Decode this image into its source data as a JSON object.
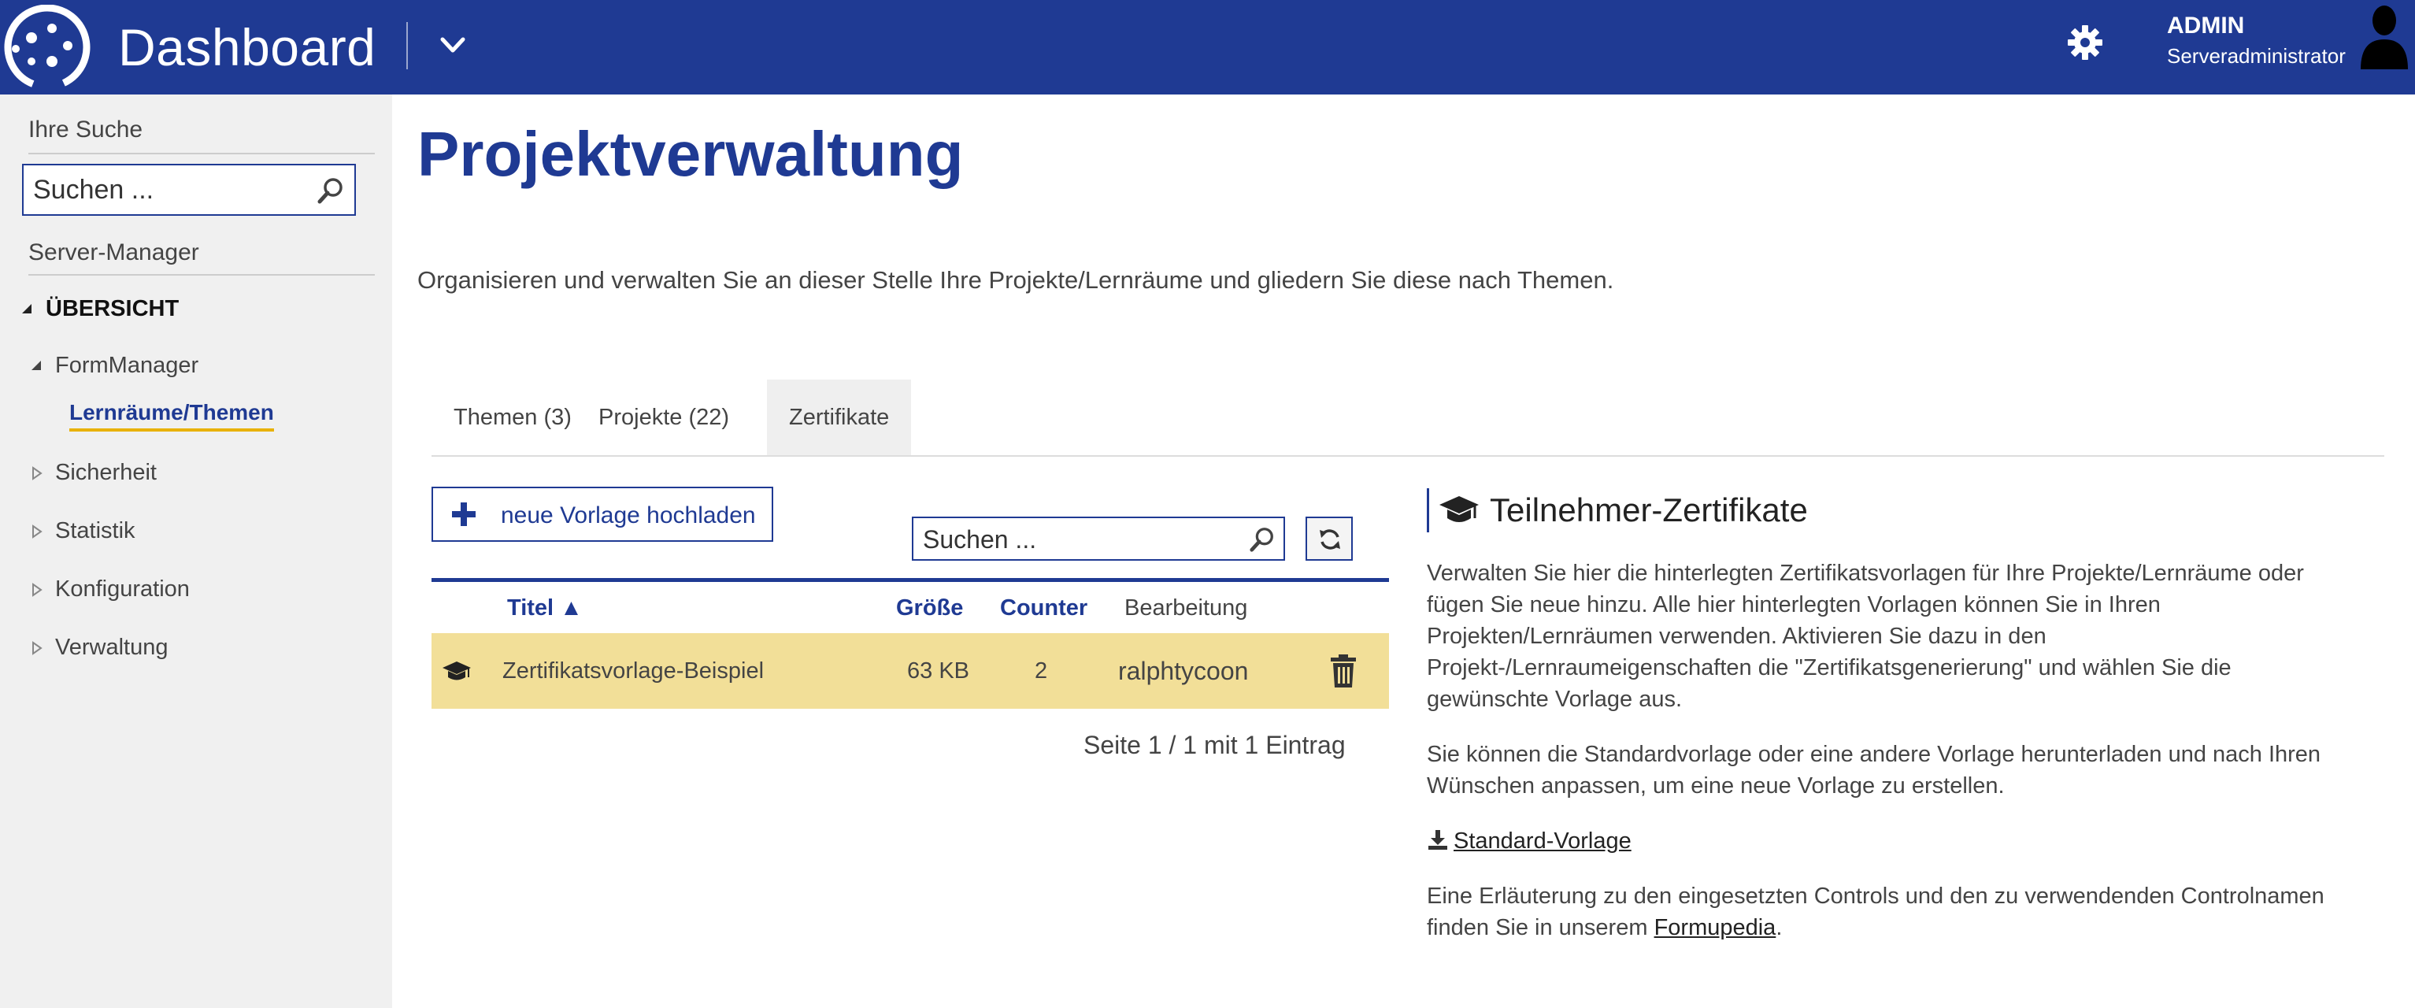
{
  "header": {
    "brand": "Dashboard",
    "user": {
      "name": "ADMIN",
      "role": "Serveradministrator"
    },
    "colors": {
      "primary": "#1f3a93"
    }
  },
  "sidebar": {
    "search_label": "Ihre Suche",
    "search_placeholder": "Suchen ...",
    "section_label": "Server-Manager",
    "overview": "ÜBERSICHT",
    "formmanager": "FormManager",
    "active_item": "Lernräume/Themen",
    "items": [
      {
        "label": "Sicherheit"
      },
      {
        "label": "Statistik"
      },
      {
        "label": "Konfiguration"
      },
      {
        "label": "Verwaltung"
      }
    ]
  },
  "main": {
    "title": "Projektverwaltung",
    "description": "Organisieren und verwalten Sie an dieser Stelle Ihre Projekte/Lernräume und gliedern Sie diese nach Themen.",
    "tabs": [
      {
        "label": "Themen (3)"
      },
      {
        "label": "Projekte (22)"
      },
      {
        "label": "Zertifikate",
        "active": true
      }
    ],
    "upload_button": "neue Vorlage hochladen",
    "search_placeholder": "Suchen ...",
    "table": {
      "columns": {
        "title": "Titel ▲",
        "size": "Größe",
        "counter": "Counter",
        "edit": "Bearbeitung"
      },
      "rows": [
        {
          "title": "Zertifikatsvorlage-Beispiel",
          "size": "63 KB",
          "counter": "2",
          "edit": "ralphtycoon"
        }
      ],
      "pager": "Seite 1 / 1 mit 1 Eintrag",
      "row_highlight": "#f2df98"
    }
  },
  "info": {
    "title": "Teilnehmer-Zertifikate",
    "p1_lines": [
      "Verwalten Sie hier die hinterlegten Zertifikatsvorlagen für Ihre Projekte/Lernräume oder",
      "fügen Sie neue hinzu. Alle hier hinterlegten Vorlagen können Sie in Ihren",
      "Projekten/Lernräumen verwenden. Aktivieren Sie dazu in den",
      "Projekt-/Lernraumeigenschaften die \"Zertifikatsgenerierung\" und wählen Sie die",
      "gewünschte Vorlage aus."
    ],
    "p2_lines": [
      "Sie können die Standardvorlage oder eine andere Vorlage herunterladen und nach Ihren",
      "Wünschen anpassen, um eine neue Vorlage zu erstellen."
    ],
    "download_link": "Standard-Vorlage",
    "p3_line1": "Eine Erläuterung zu den eingesetzten Controls und den zu verwendenden Controlnamen",
    "p3_prefix": "finden Sie in unserem ",
    "p3_link": "Formupedia",
    "p3_suffix": "."
  }
}
